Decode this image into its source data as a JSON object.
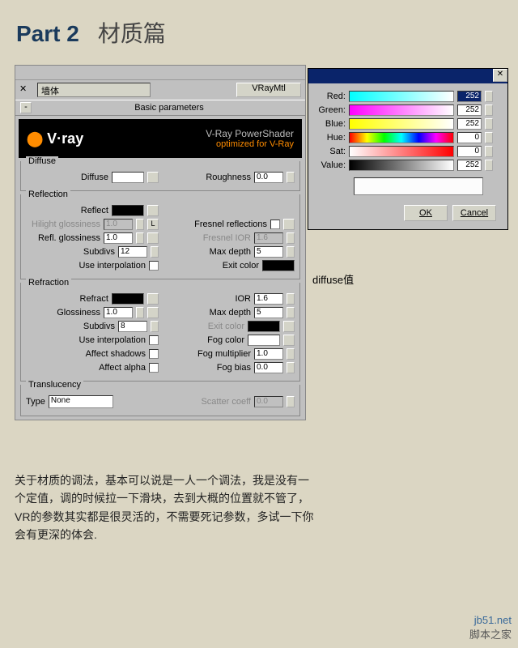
{
  "title": {
    "part": "Part 2",
    "cn": "材质篇"
  },
  "dropdown": "墙体",
  "mtl_button": "VRayMtl",
  "basic_params": "Basic parameters",
  "banner": {
    "logo_prefix": "V·",
    "logo": "ray",
    "line1": "V-Ray PowerShader",
    "line2": "optimized for V-Ray"
  },
  "groups": {
    "diffuse": {
      "label": "Diffuse",
      "diffuse_lbl": "Diffuse",
      "roughness_lbl": "Roughness",
      "roughness": "0.0"
    },
    "reflection": {
      "label": "Reflection",
      "reflect_lbl": "Reflect",
      "hilight_lbl": "Hilight glossiness",
      "hilight": "1.0",
      "refl_gloss_lbl": "Refl. glossiness",
      "refl_gloss": "1.0",
      "subdivs_lbl": "Subdivs",
      "subdivs": "12",
      "interp_lbl": "Use interpolation",
      "L": "L",
      "fresnel_lbl": "Fresnel reflections",
      "fresnel_ior_lbl": "Fresnel IOR",
      "fresnel_ior": "1.6",
      "maxdepth_lbl": "Max depth",
      "maxdepth": "5",
      "exit_lbl": "Exit color"
    },
    "refraction": {
      "label": "Refraction",
      "refract_lbl": "Refract",
      "gloss_lbl": "Glossiness",
      "gloss": "1.0",
      "subdivs_lbl": "Subdivs",
      "subdivs": "8",
      "interp_lbl": "Use interpolation",
      "shadows_lbl": "Affect shadows",
      "alpha_lbl": "Affect alpha",
      "ior_lbl": "IOR",
      "ior": "1.6",
      "maxdepth_lbl": "Max depth",
      "maxdepth": "5",
      "exit_lbl": "Exit color",
      "fog_lbl": "Fog color",
      "fogmult_lbl": "Fog multiplier",
      "fogmult": "1.0",
      "fogbias_lbl": "Fog bias",
      "fogbias": "0.0"
    },
    "translucency": {
      "label": "Translucency",
      "type_lbl": "Type",
      "type": "None",
      "scatter_lbl": "Scatter coeff",
      "scatter": "0.0"
    }
  },
  "color_dlg": {
    "red_lbl": "Red:",
    "red": "252",
    "green_lbl": "Green:",
    "green": "252",
    "blue_lbl": "Blue:",
    "blue": "252",
    "hue_lbl": "Hue:",
    "hue": "0",
    "sat_lbl": "Sat:",
    "sat": "0",
    "val_lbl": "Value:",
    "val": "252",
    "ok": "OK",
    "cancel": "Cancel"
  },
  "diffuse_note": "diffuse值",
  "body_text": "关于材质的调法，基本可以说是一人一个调法，我是没有一个定值，调的时候拉一下滑块，去到大概的位置就不管了，VR的参数其实都是很灵活的，不需要死记参数，多试一下你会有更深的体会.",
  "watermark": {
    "url": "jb51.net",
    "cn": "脚本之家"
  }
}
